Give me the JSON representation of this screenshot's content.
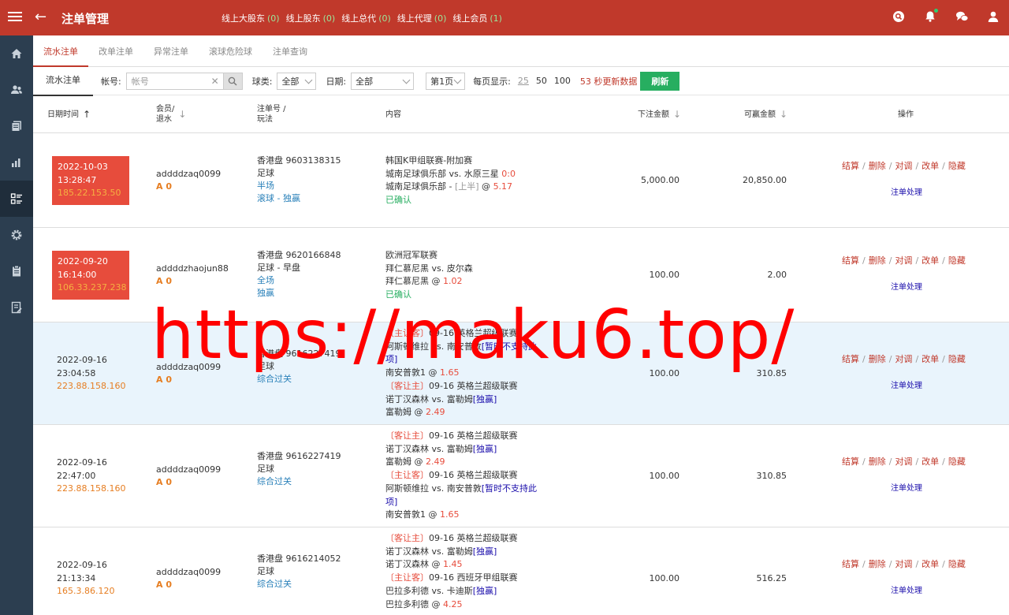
{
  "header": {
    "title": "注单管理",
    "nav": [
      {
        "label": "线上大股东",
        "count": "(0)"
      },
      {
        "label": "线上股东",
        "count": "(0)"
      },
      {
        "label": "线上总代",
        "count": "(0)"
      },
      {
        "label": "线上代理",
        "count": "(0)"
      },
      {
        "label": "线上会员",
        "count": "(1)"
      }
    ]
  },
  "tabs": [
    "流水注单",
    "改单注单",
    "异常注单",
    "滚球危险球",
    "注单查询"
  ],
  "filters": {
    "sub_tab": "流水注单",
    "account_label": "帐号:",
    "account_placeholder": "帐号",
    "ball_label": "球类:",
    "ball_value": "全部",
    "date_label": "日期:",
    "date_value": "全部",
    "page_value": "第1页",
    "per_page_label": "每页显示:",
    "per_page_options": [
      "25",
      "50",
      "100"
    ],
    "countdown": "53 秒更新数据",
    "refresh_label": "刷新"
  },
  "columns": {
    "datetime": "日期时间",
    "member": "会员/",
    "rebate": "退水",
    "order_no": "注单号 /",
    "play": "玩法",
    "content": "内容",
    "stake": "下注金额",
    "winnable": "可赢金额",
    "action": "操作"
  },
  "row_actions": [
    "结算",
    "删除",
    "对调",
    "改单",
    "隐藏"
  ],
  "row_process": "注单处理",
  "rows": [
    {
      "date": "2022-10-03",
      "time": "13:28:47",
      "ip": "185.22.153.50",
      "member": "addddzaq0099",
      "grade": "A 0",
      "order": "香港盘 9603138315",
      "sport": "足球",
      "p1": "半场",
      "p2": "滚球 - 独赢",
      "c1": "韩国K甲组联赛-附加赛",
      "c2a": "城南足球俱乐部  vs.  水原三星",
      "c2b": "0:0",
      "c3a": "城南足球俱乐部  - ",
      "c3b": "[上半]",
      "c3c": " @ ",
      "c3d": "5.17",
      "c4": "已确认",
      "stake": "5,000.00",
      "win": "20,850.00"
    },
    {
      "date": "2022-09-20",
      "time": "16:14:00",
      "ip": "106.33.237.238",
      "member": "addddzhaojun88",
      "grade": "A 0",
      "order": "香港盘 9620166848",
      "sport": "足球 - 早盘",
      "p1": "全场",
      "p2": "独赢",
      "c1": "欧洲冠军联赛",
      "c2": "拜仁慕尼黑  vs.  皮尔森",
      "c3a": "拜仁慕尼黑 @ ",
      "c3d": "1.02",
      "c4": "已确认",
      "stake": "100.00",
      "win": "2.00"
    },
    {
      "date": "2022-09-16",
      "time": "23:04:58",
      "ip": "223.88.158.160",
      "member": "addddzaq0099",
      "grade": "A 0",
      "order": "香港盘 9616227419",
      "sport": "足球",
      "p1": "综合过关",
      "legs": [
        {
          "tag": "〔主让客〕",
          "league": "09-16 英格兰超级联赛",
          "match": "阿斯顿维拉 vs. 南安普敦",
          "note": "[暂时不支持此",
          "note2": "项]",
          "pick": "南安普敦1 @ ",
          "odds": "1.65"
        },
        {
          "tag": "〔客让主〕",
          "league": "09-16 英格兰超级联赛",
          "match": "诺丁汉森林 vs. 富勒姆",
          "note": "[独赢]",
          "pick": "富勒姆 @ ",
          "odds": "2.49"
        }
      ],
      "stake": "100.00",
      "win": "310.85"
    },
    {
      "date": "2022-09-16",
      "time": "22:47:00",
      "ip": "223.88.158.160",
      "member": "addddzaq0099",
      "grade": "A 0",
      "order": "香港盘 9616227419",
      "sport": "足球",
      "p1": "综合过关",
      "legs": [
        {
          "tag": "〔客让主〕",
          "league": "09-16 英格兰超级联赛",
          "match": "诺丁汉森林 vs. 富勒姆",
          "note": "[独赢]",
          "pick": "富勒姆 @ ",
          "odds": "2.49"
        },
        {
          "tag": "〔主让客〕",
          "league": "09-16 英格兰超级联赛",
          "match": "阿斯顿维拉 vs. 南安普敦",
          "note": "[暂时不支持此",
          "note2": "项]",
          "pick": "南安普敦1 @ ",
          "odds": "1.65"
        }
      ],
      "stake": "100.00",
      "win": "310.85"
    },
    {
      "date": "2022-09-16",
      "time": "21:13:34",
      "ip": "165.3.86.120",
      "member": "addddzaq0099",
      "grade": "A 0",
      "order": "香港盘 9616214052",
      "sport": "足球",
      "p1": "综合过关",
      "legs": [
        {
          "tag": "〔客让主〕",
          "league": "09-16 英格兰超级联赛",
          "match": "诺丁汉森林 vs. 富勒姆",
          "note": "[独赢]",
          "pick": "诺丁汉森林 @ ",
          "odds": "1.45"
        },
        {
          "tag": "〔主让客〕",
          "league": "09-16 西班牙甲组联赛",
          "match": "巴拉多利德 vs. 卡迪斯",
          "note": "[独赢]",
          "pick": "巴拉多利德 @ ",
          "odds": "4.25"
        }
      ],
      "stake": "100.00",
      "win": "516.25"
    }
  ],
  "watermark": "https://maku6.top/"
}
